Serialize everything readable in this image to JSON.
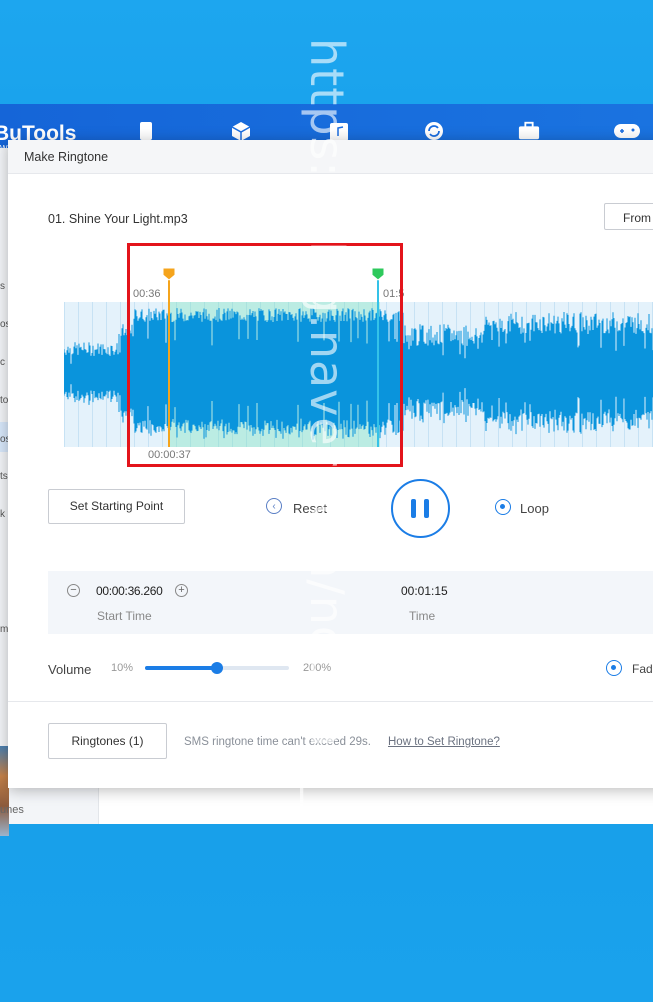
{
  "background_app": {
    "title": "BuTools",
    "subtitle": "W",
    "header_icons": [
      "phone-icon",
      "cube-icon",
      "music-icon",
      "sync-icon",
      "toolbox-icon",
      "gamepad-icon"
    ],
    "sidebar_fragments": [
      "s",
      "os",
      "c",
      "to",
      "os",
      "ts",
      "k",
      "m"
    ],
    "footer": "unes"
  },
  "dialog": {
    "title": "Make Ringtone",
    "filename": "01. Shine Your Light.mp3",
    "from_button": "From",
    "waveform": {
      "start_marker_time": "00:36",
      "end_marker_time": "01:5",
      "cursor_time": "00:00:37",
      "colors": {
        "wave": "#0a94dc",
        "selection": "#7ce1be",
        "start_marker": "#f5a41c",
        "end_marker": "#2ec95c",
        "highlight_box": "#e3141b"
      }
    },
    "controls": {
      "set_starting_point": "Set Starting Point",
      "reset": "Reset",
      "loop": "Loop"
    },
    "time_panel": {
      "start_time_value": "00:00:36.260",
      "start_time_label": "Start Time",
      "time_value": "00:01:15",
      "time_label": "Time"
    },
    "volume": {
      "label": "Volume",
      "min": "10%",
      "max": "200%",
      "level_fraction": 0.5
    },
    "fade_label": "Fad",
    "footer": {
      "ringtones_button": "Ringtones (1)",
      "sms_note": "SMS ringtone time can't exceed 29s.",
      "how_to_link": "How to Set Ringtone?"
    }
  },
  "watermark": "https://blog.naver.com/nothink__"
}
